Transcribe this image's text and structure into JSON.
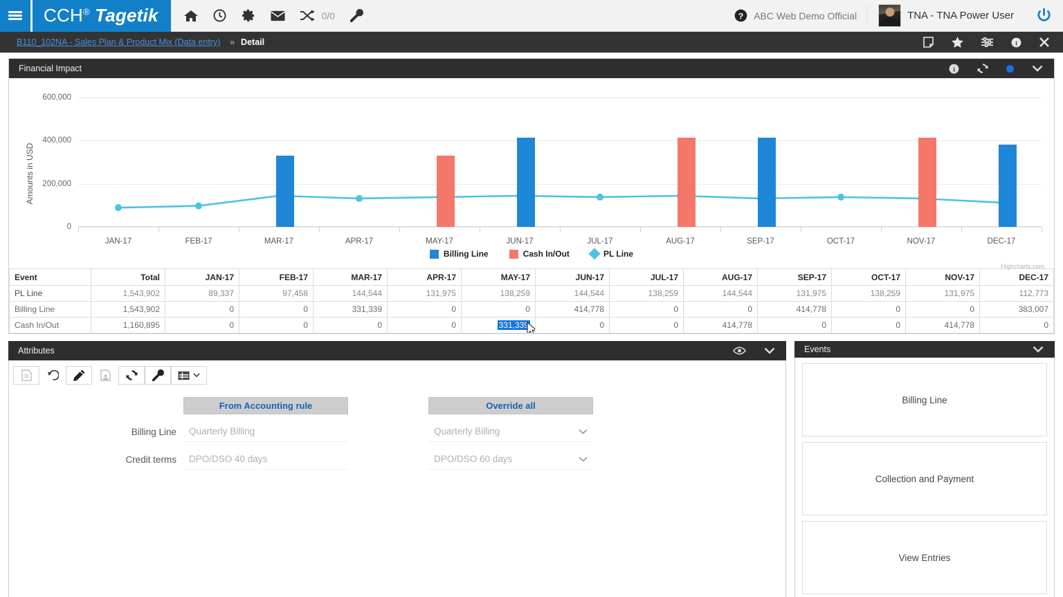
{
  "topbar": {
    "menu_icon": "hamburger-icon",
    "logo_cch": "CCH",
    "logo_sup": "®",
    "logo_tagetik": "Tagetik",
    "icons": [
      "home-icon",
      "clock-icon",
      "gear-icon",
      "envelope-icon",
      "shuffle-icon"
    ],
    "counter": "0/0",
    "wrench_icon": "wrench-icon",
    "help_icon": "help-icon",
    "help_label": "ABC Web Demo Official",
    "avatar": "user-avatar",
    "user_label": "TNA - TNA Power User",
    "power_icon": "power-icon"
  },
  "breadcrumb": {
    "link": "B110_102NA - Sales Plan & Product Mix (Data entry)",
    "separator": "»",
    "current": "Detail",
    "icons": [
      "note-icon",
      "star-icon",
      "filter-icon",
      "info-icon",
      "close-icon"
    ]
  },
  "financial_panel": {
    "title": "Financial Impact",
    "icons": [
      "info-icon",
      "refresh-icon",
      "status-dot-icon",
      "chevron-down-icon"
    ]
  },
  "chart_data": {
    "type": "bar",
    "title": "Financial Impact",
    "xlabel": "",
    "ylabel": "Amounts in USD",
    "ylim": [
      0,
      600000
    ],
    "yticks": [
      0,
      200000,
      400000,
      600000
    ],
    "ytick_labels": [
      "0",
      "200,000",
      "400,000",
      "600,000"
    ],
    "categories": [
      "JAN-17",
      "FEB-17",
      "MAR-17",
      "APR-17",
      "MAY-17",
      "JUN-17",
      "JUL-17",
      "AUG-17",
      "SEP-17",
      "OCT-17",
      "NOV-17",
      "DEC-17"
    ],
    "grid": true,
    "legend_position": "bottom",
    "credit": "Highcharts.com",
    "series": [
      {
        "name": "Billing Line",
        "type": "bar",
        "color": "#1f87d8",
        "values": [
          0,
          0,
          331339,
          0,
          0,
          414778,
          0,
          0,
          414778,
          0,
          0,
          383007
        ]
      },
      {
        "name": "Cash In/Out",
        "type": "bar",
        "color": "#f4776a",
        "values": [
          0,
          0,
          0,
          0,
          331339,
          0,
          0,
          414778,
          0,
          0,
          414778,
          0
        ]
      },
      {
        "name": "PL Line",
        "type": "line",
        "color": "#4ec3e0",
        "values": [
          89337,
          97458,
          144544,
          131975,
          138259,
          144544,
          138259,
          144544,
          131975,
          138259,
          131975,
          112773
        ]
      }
    ]
  },
  "table": {
    "columns": [
      "Event",
      "Total",
      "JAN-17",
      "FEB-17",
      "MAR-17",
      "APR-17",
      "MAY-17",
      "JUN-17",
      "JUL-17",
      "AUG-17",
      "SEP-17",
      "OCT-17",
      "NOV-17",
      "DEC-17"
    ],
    "rows": [
      {
        "event": "PL Line",
        "total": "1,543,902",
        "values": [
          "89,337",
          "97,458",
          "144,544",
          "131,975",
          "138,259",
          "144,544",
          "138,259",
          "144,544",
          "131,975",
          "138,259",
          "131,975",
          "112,773"
        ]
      },
      {
        "event": "Billing Line",
        "total": "1,543,902",
        "values": [
          "0",
          "0",
          "331,339",
          "0",
          "0",
          "414,778",
          "0",
          "0",
          "414,778",
          "0",
          "0",
          "383,007"
        ]
      },
      {
        "event": "Cash In/Out",
        "total": "1,160,895",
        "values": [
          "0",
          "0",
          "0",
          "0",
          "331,339",
          "0",
          "0",
          "414,778",
          "0",
          "0",
          "414,778",
          "0"
        ]
      }
    ],
    "selected_cell": {
      "row": 2,
      "col": 4,
      "value": "331,339"
    }
  },
  "attributes_panel": {
    "title": "Attributes",
    "head_icons": [
      "eye-icon",
      "chevron-down-icon"
    ],
    "toolbar": [
      "new-document-icon",
      "undo-icon",
      "edit-pencil-icon",
      "save-document-icon",
      "refresh-icon",
      "wrench-icon",
      "table-icon",
      "chevron-down-icon"
    ],
    "col_header_left": "From Accounting rule",
    "col_header_right": "Override all",
    "fields": [
      {
        "label": "Billing Line",
        "from_rule": "Quarterly Billing",
        "override": "Quarterly Billing"
      },
      {
        "label": "Credit terms",
        "from_rule": "DPO/DSO 40 days",
        "override": "DPO/DSO 60 days"
      }
    ]
  },
  "events_panel": {
    "title": "Events",
    "head_icons": [
      "chevron-down-icon"
    ],
    "buttons": [
      "Billing Line",
      "Collection and Payment",
      "View Entries"
    ]
  },
  "colors": {
    "brand_blue": "#1280c8",
    "bar_blue": "#1f87d8",
    "bar_red": "#f4776a",
    "line_cyan": "#4ec3e0",
    "panel_header": "#2e2e2e",
    "crumb_bar": "#333333",
    "selection_blue": "#1574e0"
  }
}
